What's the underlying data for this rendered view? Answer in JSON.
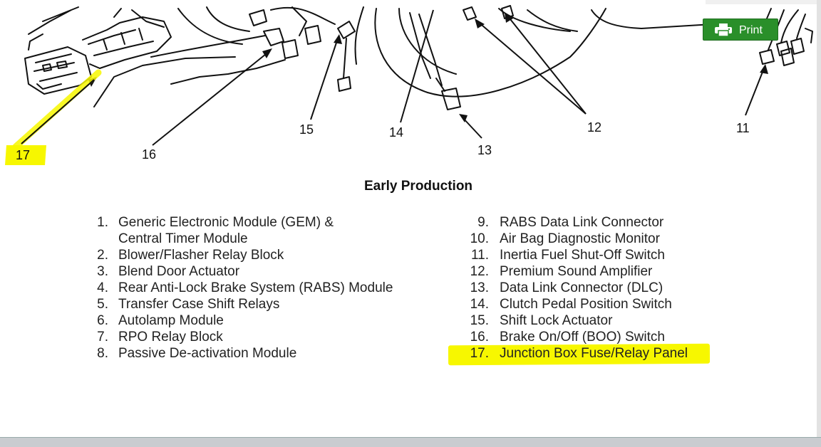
{
  "diagram": {
    "callouts": [
      {
        "n": "17"
      },
      {
        "n": "16"
      },
      {
        "n": "15"
      },
      {
        "n": "14"
      },
      {
        "n": "13"
      },
      {
        "n": "12"
      },
      {
        "n": "11"
      }
    ],
    "caption": "Early Production",
    "highlight_color": "#f7f700"
  },
  "legend": {
    "left": [
      {
        "num": "1.",
        "label": "Generic Electronic Module (GEM) &"
      },
      {
        "num": "",
        "label": "Central Timer Module"
      },
      {
        "num": "2.",
        "label": "Blower/Flasher Relay Block"
      },
      {
        "num": "3.",
        "label": "Blend Door Actuator"
      },
      {
        "num": "4.",
        "label": "Rear Anti-Lock Brake System (RABS) Module"
      },
      {
        "num": "5.",
        "label": "Transfer Case Shift Relays"
      },
      {
        "num": "6.",
        "label": "Autolamp Module"
      },
      {
        "num": "7.",
        "label": "RPO Relay Block"
      },
      {
        "num": "8.",
        "label": "Passive De-activation Module"
      }
    ],
    "right": [
      {
        "num": "9.",
        "label": "RABS Data Link Connector"
      },
      {
        "num": "10.",
        "label": "Air Bag Diagnostic Monitor"
      },
      {
        "num": "11.",
        "label": "Inertia Fuel Shut-Off Switch"
      },
      {
        "num": "12.",
        "label": "Premium Sound Amplifier"
      },
      {
        "num": "13.",
        "label": "Data Link Connector (DLC)"
      },
      {
        "num": "14.",
        "label": "Clutch Pedal Position Switch"
      },
      {
        "num": "15.",
        "label": "Shift Lock Actuator"
      },
      {
        "num": "16.",
        "label": "Brake On/Off (BOO) Switch"
      },
      {
        "num": "17.",
        "label": "Junction Box Fuse/Relay Panel",
        "highlighted": true
      }
    ]
  },
  "toolbar": {
    "print_label": "Print",
    "print_icon": "printer-icon",
    "accent": "#2a8f2a"
  }
}
